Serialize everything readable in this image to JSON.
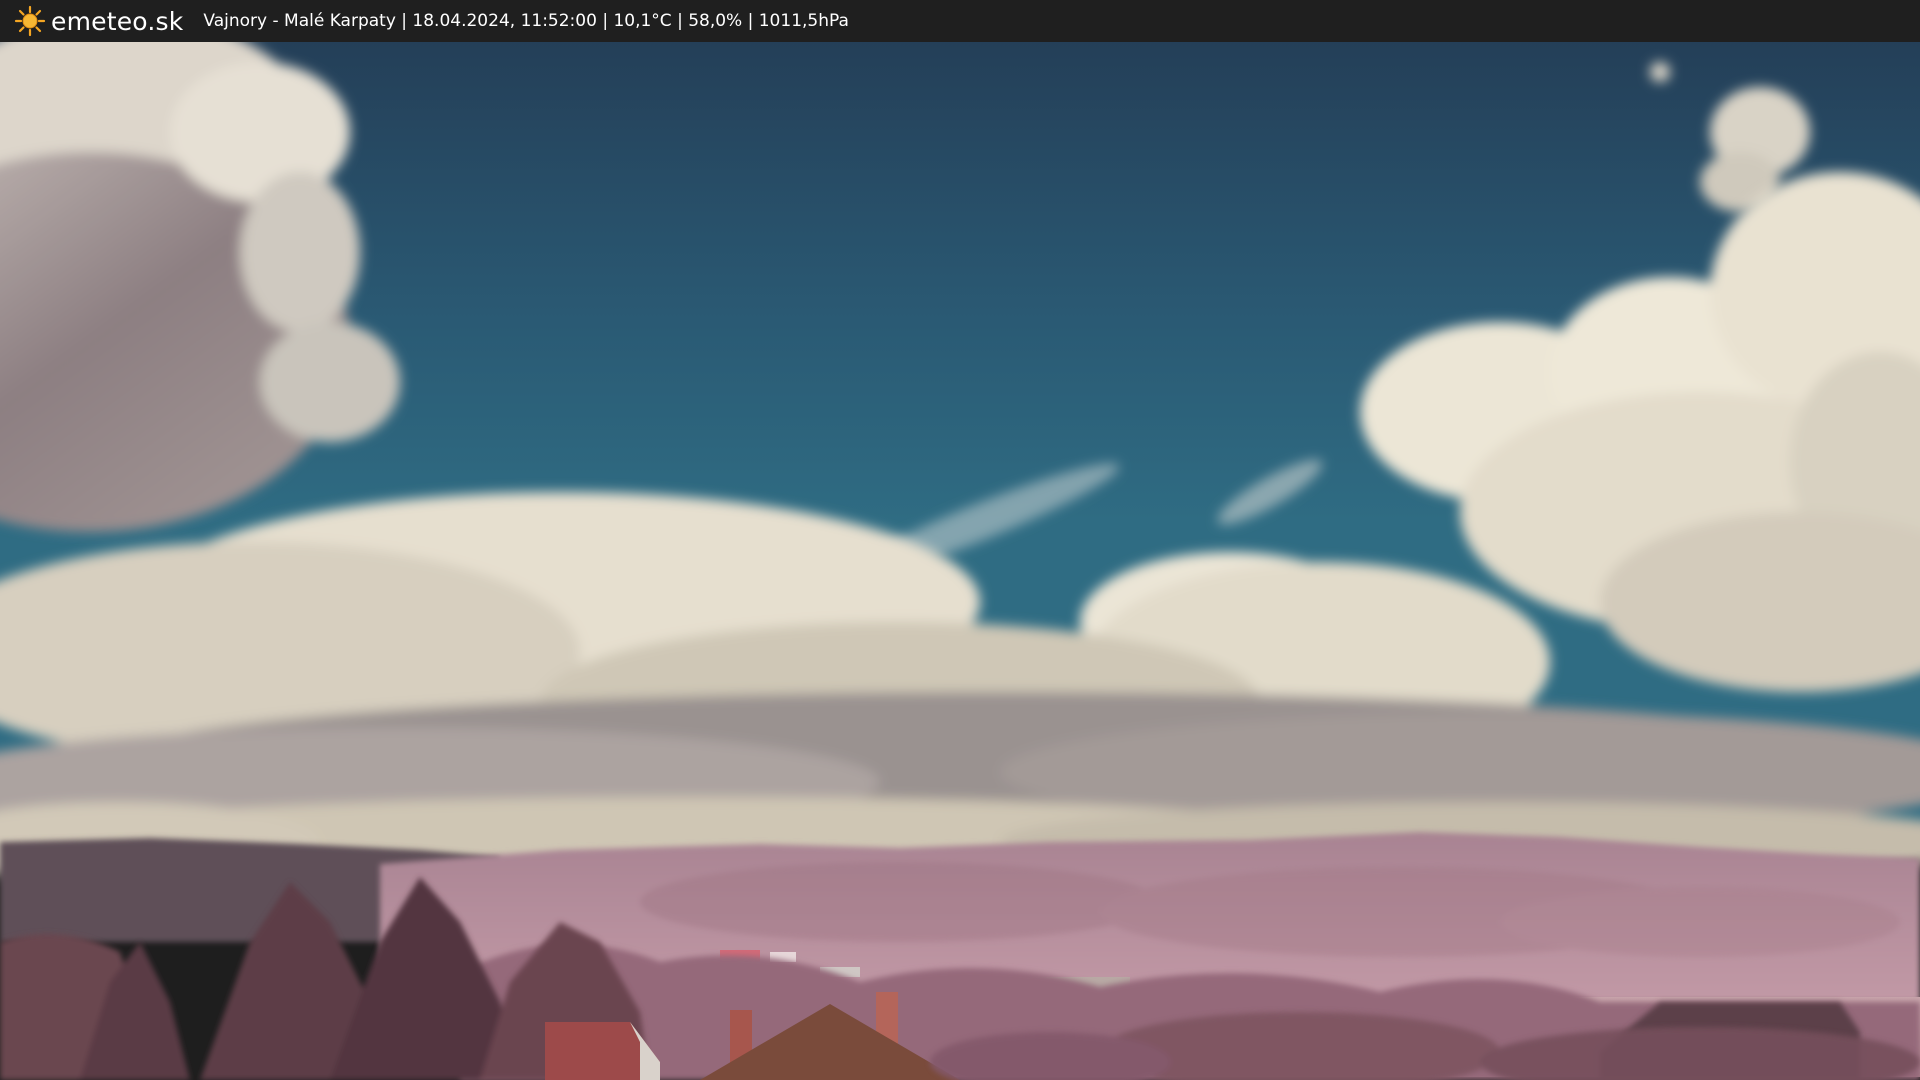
{
  "header": {
    "logo_icon": "sun-icon",
    "brand": "emeteo.sk",
    "caption": "Vajnory - Malé Karpaty | 18.04.2024, 11:52:00 | 10,1°C | 58,0% | 1011,5hPa"
  },
  "colors": {
    "bar": "#1f1f1f",
    "sun": "#f5a623",
    "sky": "#2b6078",
    "cloud": "#e8e1cf",
    "hills": "#b58a99",
    "foliage": "#8a5a65"
  }
}
